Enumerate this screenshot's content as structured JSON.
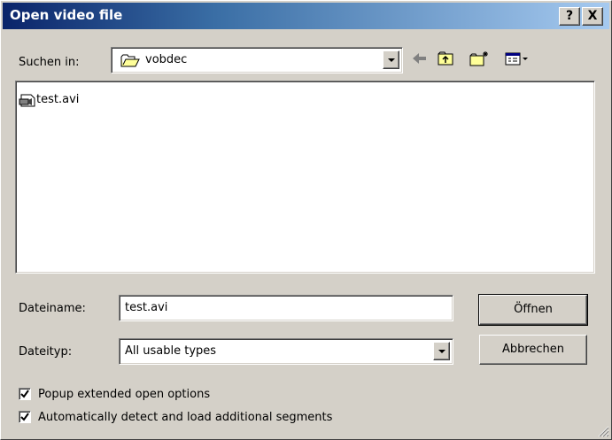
{
  "dialog": {
    "title": "Open video file",
    "help_label": "?",
    "close_label": "X"
  },
  "look_in": {
    "label": "Suchen in:",
    "value": "vobdec",
    "icon": "folder-icon"
  },
  "toolbar": {
    "icons": [
      "back-arrow-icon",
      "up-folder-icon",
      "new-folder-icon",
      "view-menu-icon"
    ]
  },
  "files": [
    {
      "name": "test.avi",
      "icon": "video-file-icon"
    }
  ],
  "filename": {
    "label": "Dateiname:",
    "value": "test.avi"
  },
  "filetype": {
    "label": "Dateityp:",
    "value": "All usable types"
  },
  "buttons": {
    "open": "Öffnen",
    "cancel": "Abbrechen"
  },
  "options": [
    {
      "label": "Popup extended open options",
      "checked": true
    },
    {
      "label": "Automatically detect and load additional segments",
      "checked": true
    }
  ]
}
